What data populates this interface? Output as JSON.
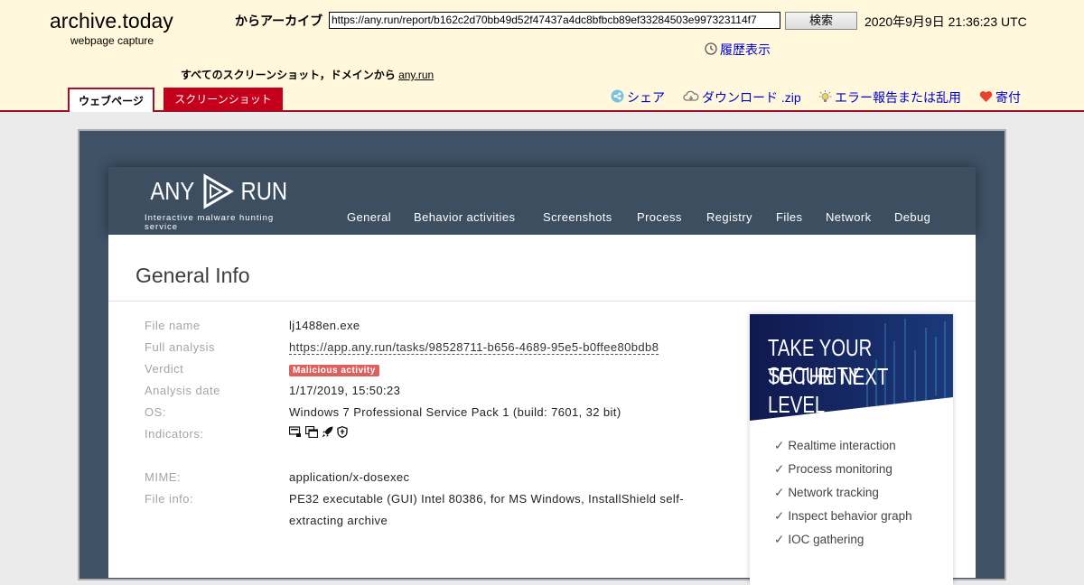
{
  "archive": {
    "title": "archive.today",
    "subtitle": "webpage capture",
    "archive_label": "からアーカイブ",
    "url_value": "https://any.run/report/b162c2d70bb49d52f47437a4dc8bfbcb89ef33284503e997323114f7",
    "search_label": "検索",
    "timestamp": "2020年9月9日 21:36:23 UTC",
    "history_label": "履歴表示",
    "all_screenshots_label": "すべてのスクリーンショット，ドメインから",
    "domain_link": "any.run",
    "tabs": {
      "webpage": "ウェブページ",
      "screenshot": "スクリーンショット"
    },
    "actions": {
      "share": "シェア",
      "download": "ダウンロード .zip",
      "report": "エラー報告または乱用",
      "donate": "寄付"
    }
  },
  "anyrun": {
    "logo_left": "ANY",
    "logo_right": "RUN",
    "tagline": "Interactive malware hunting service",
    "nav": [
      "General",
      "Behavior activities",
      "Screenshots",
      "Process",
      "Registry",
      "Files",
      "Network",
      "Debug"
    ],
    "section_title": "General Info",
    "fields": {
      "file_name": {
        "label": "File name",
        "value": "lj1488en.exe"
      },
      "full_analysis": {
        "label": "Full analysis",
        "value": "https://app.any.run/tasks/98528711-b656-4689-95e5-b0ffee80bdb8"
      },
      "verdict": {
        "label": "Verdict",
        "value": "Malicious activity"
      },
      "analysis_date": {
        "label": "Analysis date",
        "value": "1/17/2019, 15:50:23"
      },
      "os": {
        "label": "OS:",
        "value": "Windows 7 Professional Service Pack 1 (build: 7601, 32 bit)"
      },
      "indicators": {
        "label": "Indicators:",
        "icons": [
          "executable-icon",
          "windows-icon",
          "rocket-icon",
          "shield-icon"
        ]
      },
      "mime": {
        "label": "MIME:",
        "value": "application/x-dosexec"
      },
      "file_info": {
        "label": "File info:",
        "line1": "PE32 executable (GUI) Intel 80386, for MS Windows, InstallShield self-",
        "line2": "extracting archive"
      }
    },
    "promo": {
      "line1": "TAKE YOUR SECURITY",
      "line2": "TO THE NEXT LEVEL",
      "items": [
        "Realtime interaction",
        "Process monitoring",
        "Network tracking",
        "Inspect behavior graph",
        "IOC gathering"
      ]
    }
  },
  "colors": {
    "archive_bg": "#fff8dc",
    "archive_accent": "#a0102a",
    "anyrun_nav": "#3c4e60",
    "verdict_badge": "#db6060",
    "promo_bg": "#13205a"
  }
}
